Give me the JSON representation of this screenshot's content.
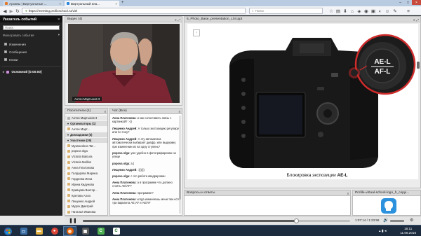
{
  "browser": {
    "tabs": [
      {
        "label": "Архивы | Виртуальные ...",
        "active": false
      },
      {
        "label": "Виртуальный кла...",
        "active": true
      }
    ],
    "url": "https://meeting.proficschool.ru/viel",
    "search_placeholder": "Поиск"
  },
  "sidebar": {
    "title": "Указатель событий",
    "search_placeholder": "Поиск",
    "filter_label": "Фильтровать события",
    "filters": [
      {
        "label": "Изменения",
        "checked": true
      },
      {
        "label": "Сообщения",
        "checked": true
      },
      {
        "label": "Клики",
        "checked": true
      }
    ],
    "event": "Основной [0:00:00]"
  },
  "video": {
    "title": "Видео (4)",
    "caption": "Антон Мартынов 3"
  },
  "attendees": {
    "title": "Посетители (4)",
    "rows": [
      {
        "label": "Антон Мартынов 3",
        "kind": "self"
      },
      {
        "label": "Организаторы (1)",
        "kind": "group"
      },
      {
        "label": "Антон Март...",
        "kind": "person"
      },
      {
        "label": "Докладчики (0)",
        "kind": "group"
      },
      {
        "label": "Участники (29)",
        "kind": "group"
      },
      {
        "label": "Myasoedova Tat...",
        "kind": "person"
      },
      {
        "label": "popova olga",
        "kind": "person"
      },
      {
        "label": "Victoria Baloura",
        "kind": "person"
      },
      {
        "label": "Victoria Mallios",
        "kind": "person"
      },
      {
        "label": "Анна Платонова",
        "kind": "person"
      },
      {
        "label": "Галдарова Марина",
        "kind": "person"
      },
      {
        "label": "Гордеева Инна",
        "kind": "person"
      },
      {
        "label": "Ирина Кидунова",
        "kind": "person"
      },
      {
        "label": "Кривцова Виктор...",
        "kind": "person"
      },
      {
        "label": "Кретова Алла",
        "kind": "person"
      },
      {
        "label": "Лещенко Андрей",
        "kind": "person"
      },
      {
        "label": "Мурох Дмитрий",
        "kind": "person"
      },
      {
        "label": "Наталья Иванова",
        "kind": "person"
      }
    ]
  },
  "chat": {
    "title": "Чат (Все)",
    "messages": [
      {
        "author": "Анна Платонова",
        "text": "и как сопоставить связь с картинкой? :-))"
      },
      {
        "author": "Лещенко Андрей",
        "text": "А только экспозицию регулирую или по тону?"
      },
      {
        "author": "Лещенко Андрей",
        "text": "А эту автоматика автоматически выбирает диафр. или выдержку при изменении их на одну ступень?"
      },
      {
        "author": "popova olga",
        "text": "уже удобно в фотографирован на улице"
      },
      {
        "author": "popova olga",
        "text": "а:)"
      },
      {
        "author": "Лещенко Андрей",
        "text": ":))))))"
      },
      {
        "author": "popova olga",
        "text": "с это работа квадрирован"
      },
      {
        "author": "Анна Платонова",
        "text": "а в программе что должно стоять AE/AF?"
      },
      {
        "author": "Анна Платонова",
        "text": "программе?"
      },
      {
        "author": "Анна Платонова",
        "text": "когда изменяешь мени там есть три варианта AE,AF и AE/AF"
      }
    ]
  },
  "slides": {
    "title": "6_Photo_Base_presentation_L04.ppt",
    "caption": "Блокировка экспозиции",
    "caption_bold": "AE-L",
    "button_label_top": "AE-L",
    "button_label_bottom": "AF-L"
  },
  "questions": {
    "title": "Вопросы и ответы"
  },
  "logo_pod": {
    "title": "Profile-virtual-school-logo_h_copyi..."
  },
  "controls": {
    "time": "1:07:14 / 1:23:58",
    "progress_fraction": 0.8
  },
  "taskbar": {
    "time": "18:11",
    "date": "11.06.2016"
  }
}
